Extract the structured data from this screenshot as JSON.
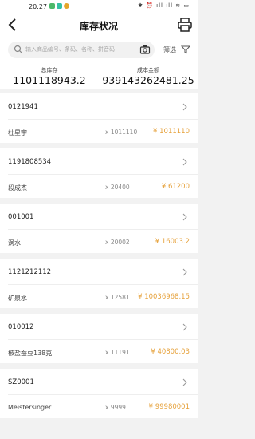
{
  "status_bar": {
    "time": "20:27",
    "icons_right": "✱ ⏰ ıll ıll ≋ ▭"
  },
  "nav": {
    "title": "库存状况"
  },
  "search": {
    "placeholder": "输入商品编号、条码、名称、拼音码",
    "filter_label": "筛选"
  },
  "summary": {
    "total_stock_label": "总库存",
    "total_stock_value": "1101118943.2",
    "cost_amount_label": "成本金额",
    "cost_amount_value": "939143262481.25"
  },
  "colors": {
    "accent": "#e6a23c"
  },
  "items": [
    {
      "code": "0121941",
      "name": "杜星宇",
      "qty": "x 1011110",
      "amount": "¥ 1011110"
    },
    {
      "code": "1191808534",
      "name": "段成杰",
      "qty": "x 20400",
      "amount": "¥ 61200"
    },
    {
      "code": "001001",
      "name": "涡水",
      "qty": "x 20002",
      "amount": "¥ 16003.2"
    },
    {
      "code": "1121212112",
      "name": "矿泉水",
      "qty": "x 12581.",
      "amount": "¥ 10036968.15"
    },
    {
      "code": "010012",
      "name": "椒盐蚕豆138克",
      "qty": "x 11191",
      "amount": "¥ 40800.03"
    },
    {
      "code": "SZ0001",
      "name": "Meistersinger",
      "qty": "x 9999",
      "amount": "¥ 99980001"
    }
  ]
}
